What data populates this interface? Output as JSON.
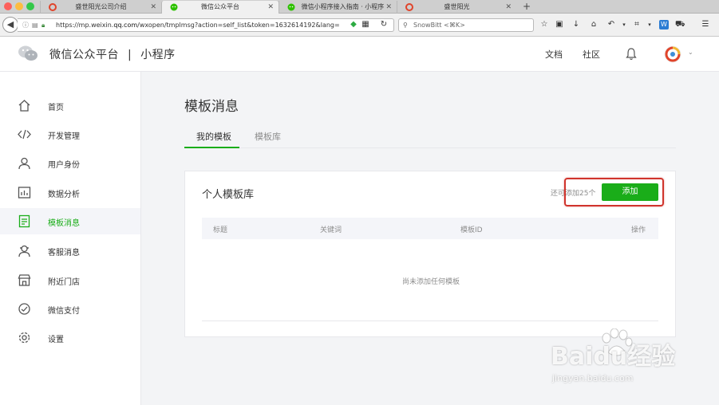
{
  "browser": {
    "tabs": [
      {
        "title": "盛世阳光公司介绍"
      },
      {
        "title": "微信公众平台"
      },
      {
        "title": "微信小程序接入指南 · 小程序"
      },
      {
        "title": "盛世阳光"
      }
    ],
    "url": "https://mp.weixin.qq.com/wxopen/tmplmsg?action=self_list&token=1632614192&lang=",
    "url_prefix": "https://mp.weixin.",
    "url_domain": "qq.com",
    "url_suffix": "/wxopen/tmplmsg?action=self_list&token=1632614192&lang=",
    "search_placeholder": "SnowBitt <⌘K>"
  },
  "header": {
    "brand": "微信公众平台",
    "separator": "|",
    "product": "小程序",
    "docs": "文档",
    "community": "社区"
  },
  "sidebar": {
    "items": [
      {
        "label": "首页",
        "icon": "home-icon"
      },
      {
        "label": "开发管理",
        "icon": "code-icon"
      },
      {
        "label": "用户身份",
        "icon": "user-icon"
      },
      {
        "label": "数据分析",
        "icon": "chart-icon"
      },
      {
        "label": "模板消息",
        "icon": "template-icon",
        "active": true
      },
      {
        "label": "客服消息",
        "icon": "service-icon"
      },
      {
        "label": "附近门店",
        "icon": "store-icon"
      },
      {
        "label": "微信支付",
        "icon": "pay-icon"
      },
      {
        "label": "设置",
        "icon": "gear-icon"
      }
    ]
  },
  "main": {
    "title": "模板消息",
    "tabs": [
      {
        "label": "我的模板",
        "active": true
      },
      {
        "label": "模板库",
        "active": false
      }
    ],
    "panel": {
      "title": "个人模板库",
      "remaining": "还可添加25个",
      "add_button": "添加",
      "columns": [
        "标题",
        "关键词",
        "模板ID",
        "操作"
      ],
      "empty_text": "尚未添加任何模板"
    }
  },
  "watermark": {
    "text": "Baidu经验",
    "url": "jingyan.baidu.com"
  },
  "colors": {
    "accent": "#1aad19",
    "highlight": "#d0342c"
  }
}
